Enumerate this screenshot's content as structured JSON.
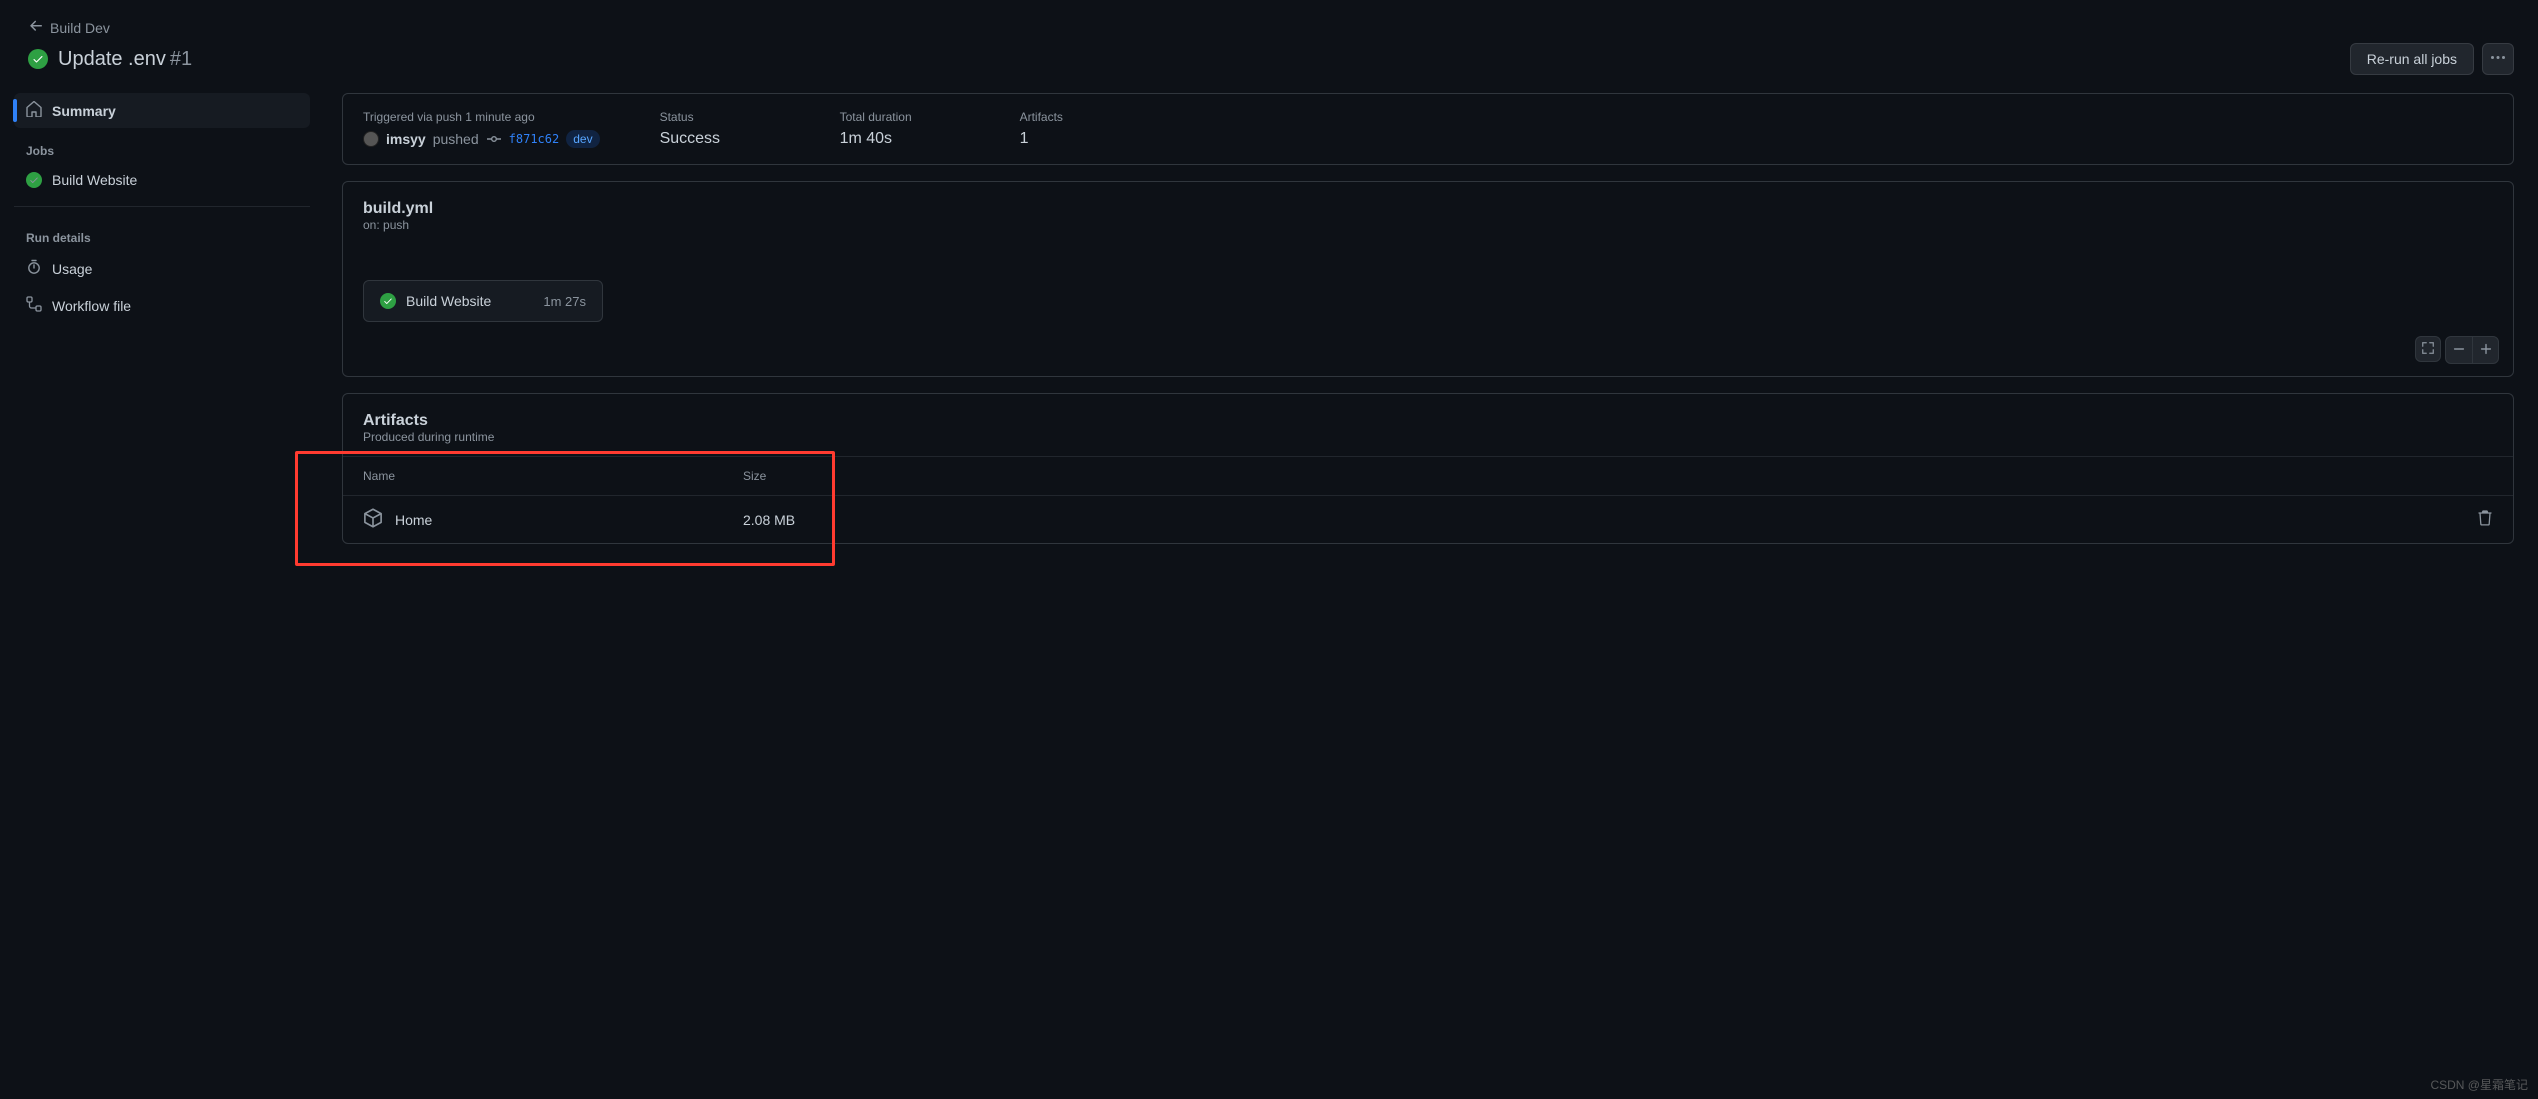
{
  "back_link": "Build Dev",
  "run_title": "Update .env",
  "run_number": "#1",
  "rerun_label": "Re-run all jobs",
  "sidebar": {
    "summary": "Summary",
    "jobs_heading": "Jobs",
    "job_items": [
      "Build Website"
    ],
    "details_heading": "Run details",
    "detail_items": [
      "Usage",
      "Workflow file"
    ]
  },
  "summary": {
    "trigger_label": "Triggered via push 1 minute ago",
    "user": "imsyy",
    "action": "pushed",
    "sha": "f871c62",
    "branch": "dev",
    "status_label": "Status",
    "status_value": "Success",
    "duration_label": "Total duration",
    "duration_value": "1m 40s",
    "artifacts_label": "Artifacts",
    "artifacts_value": "1"
  },
  "workflow": {
    "file": "build.yml",
    "trigger": "on: push",
    "job_name": "Build Website",
    "job_time": "1m 27s"
  },
  "artifacts": {
    "title": "Artifacts",
    "subtitle": "Produced during runtime",
    "col_name": "Name",
    "col_size": "Size",
    "rows": [
      {
        "name": "Home",
        "size": "2.08 MB"
      }
    ]
  },
  "watermark": "CSDN @星霜笔记"
}
